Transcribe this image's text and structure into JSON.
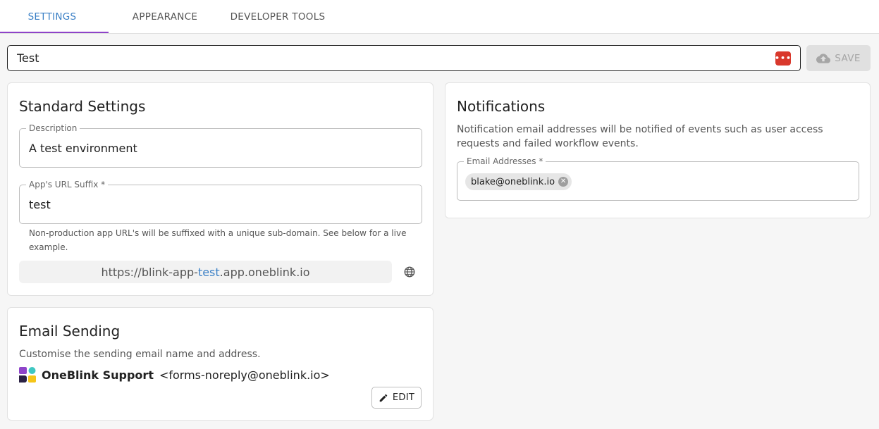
{
  "tabs": [
    {
      "label": "SETTINGS",
      "active": true
    },
    {
      "label": "APPEARANCE",
      "active": false
    },
    {
      "label": "DEVELOPER TOOLS",
      "active": false
    }
  ],
  "name_field": {
    "value": "Test",
    "icon": "password-manager-icon"
  },
  "save_button": {
    "label": "SAVE",
    "icon": "cloud-upload-icon",
    "disabled": true
  },
  "standard_settings": {
    "title": "Standard Settings",
    "description": {
      "label": "Description",
      "value": "A test environment"
    },
    "url_suffix": {
      "label": "App's URL Suffix *",
      "value": "test"
    },
    "helper": "Non-production app URL's will be suffixed with a unique sub-domain. See below for a live example.",
    "url_preview": {
      "prefix": "https://blink-app-",
      "suffix_highlight": "test",
      "domain": ".app.oneblink.io",
      "icon": "globe-icon"
    }
  },
  "email_sending": {
    "title": "Email Sending",
    "description": "Customise the sending email name and address.",
    "sender_name": "OneBlink Support",
    "sender_address": "<forms-noreply@oneblink.io>",
    "edit_label": "EDIT",
    "icon": "pencil-icon"
  },
  "notifications": {
    "title": "Notifications",
    "description": "Notification email addresses will be notified of events such as user access requests and failed workflow events.",
    "email_field": {
      "label": "Email Addresses *",
      "chips": [
        "blake@oneblink.io"
      ]
    }
  },
  "colors": {
    "accent": "#3b80c6",
    "indicator": "#8e44c9",
    "brand_purple": "#8e44c9",
    "brand_teal": "#3fc7c2",
    "brand_dark": "#2b2244",
    "brand_yellow": "#f5c518"
  }
}
